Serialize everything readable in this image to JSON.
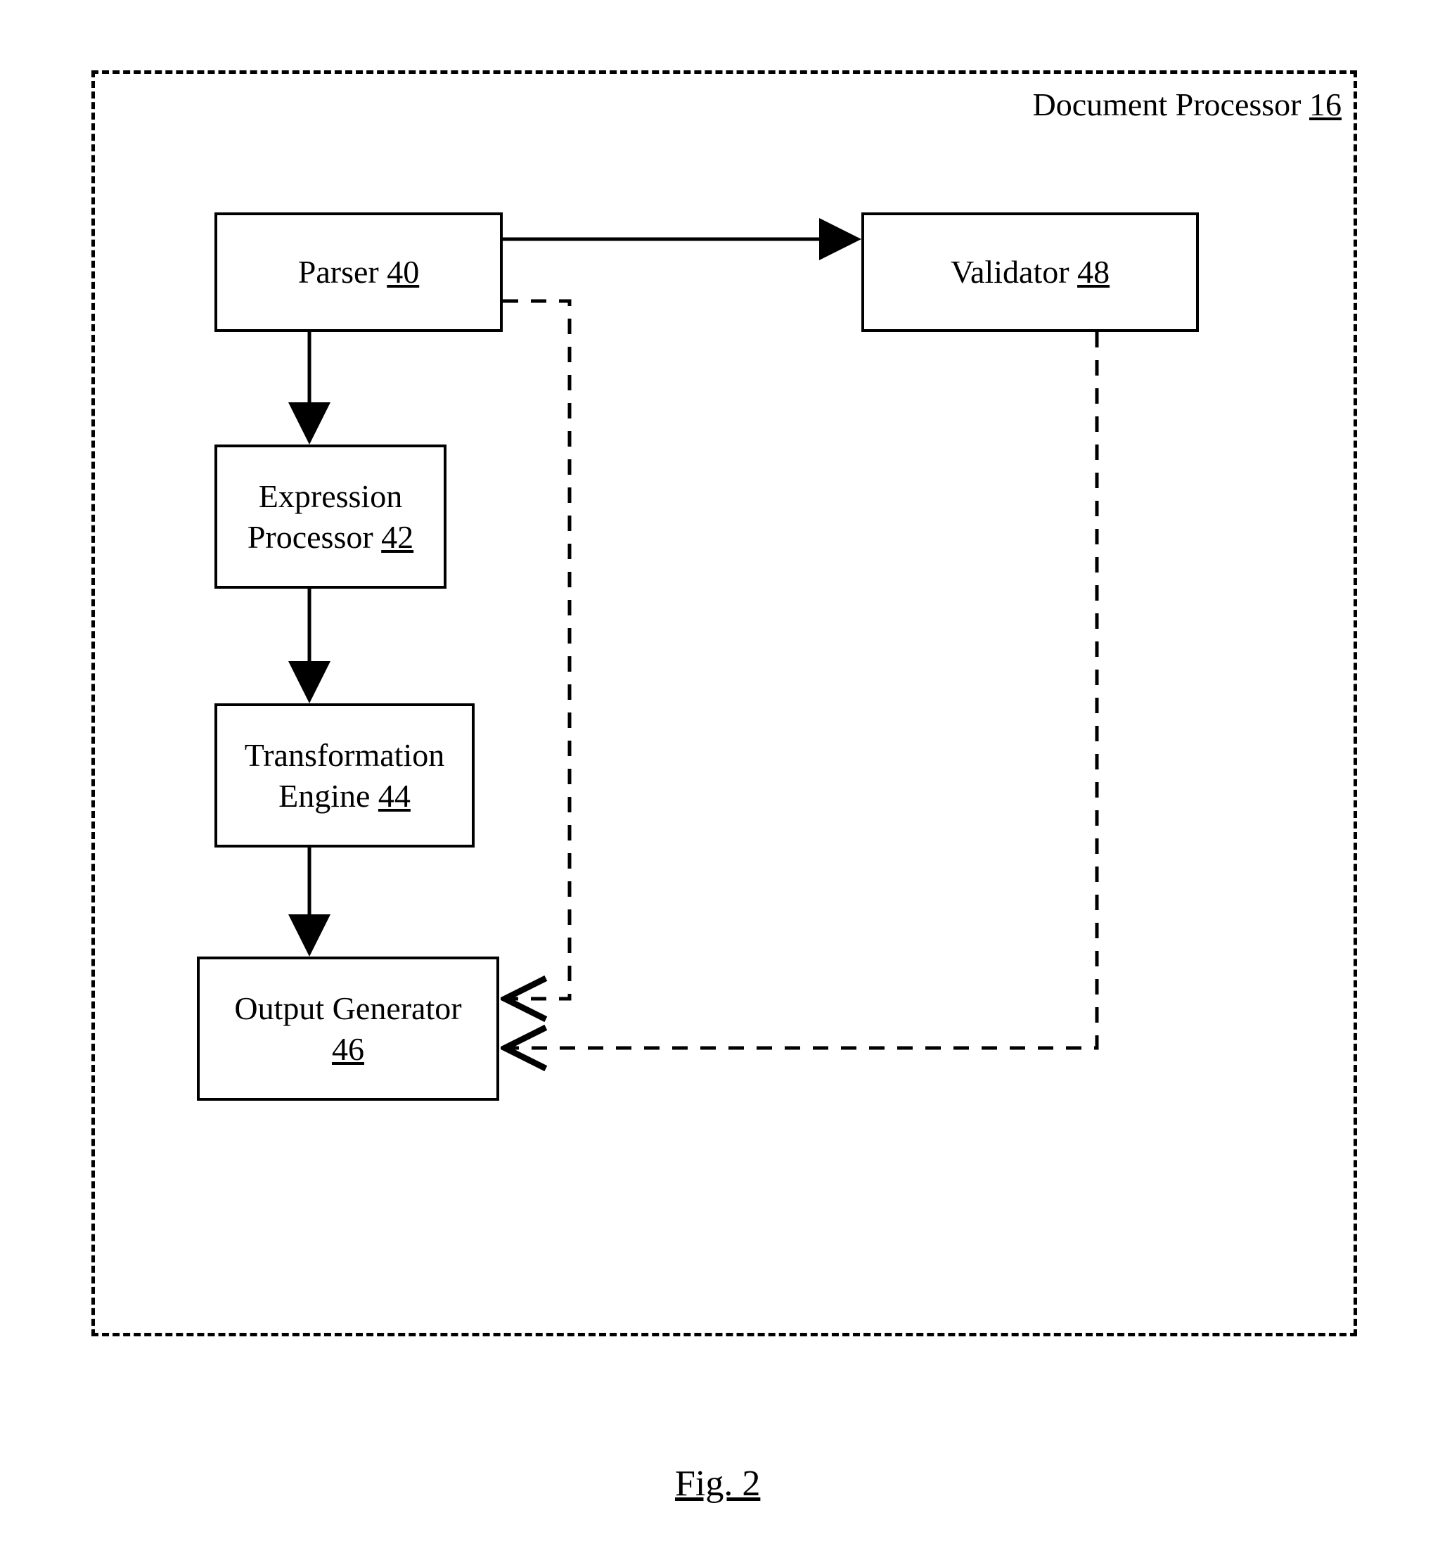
{
  "container": {
    "label_prefix": "Document Processor ",
    "label_num": "16"
  },
  "boxes": {
    "parser": {
      "text": "Parser ",
      "num": "40"
    },
    "expr": {
      "line1": "Expression",
      "line2_prefix": "Processor ",
      "num": "42"
    },
    "transform": {
      "line1": "Transformation",
      "line2_prefix": "Engine ",
      "num": "44"
    },
    "output": {
      "line1": "Output Generator",
      "num": "46"
    },
    "validator": {
      "text": "Validator ",
      "num": "48"
    }
  },
  "figure_label": "Fig. 2"
}
